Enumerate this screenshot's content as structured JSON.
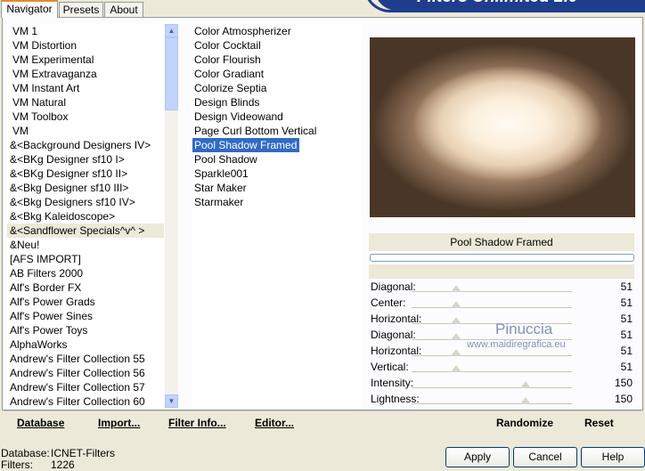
{
  "tabs": [
    "Navigator",
    "Presets",
    "About"
  ],
  "banner_title": "Filters Unlimited 2.0",
  "categories": [
    "VM 1",
    "VM Distortion",
    "VM Experimental",
    "VM Extravaganza",
    "VM Instant Art",
    "VM Natural",
    "VM Toolbox",
    "VM",
    "&<Background Designers IV>",
    "&<BKg Designer sf10 I>",
    "&<BKg Designer sf10 II>",
    "&<Bkg Designer sf10 III>",
    "&<Bkg Designers sf10 IV>",
    "&<Bkg Kaleidoscope>",
    "&<Sandflower Specials^v^ >",
    "&Neu!",
    "[AFS IMPORT]",
    "AB Filters 2000",
    "Alf's Border FX",
    "Alf's Power Grads",
    "Alf's Power Sines",
    "Alf's Power Toys",
    "AlphaWorks",
    "Andrew's Filter Collection 55",
    "Andrew's Filter Collection 56",
    "Andrew's Filter Collection 57",
    "Andrew's Filter Collection 60"
  ],
  "filters": [
    "Color Atmospherizer",
    "Color Cocktail",
    "Color Flourish",
    "Color Gradiant",
    "Colorize Septia",
    "Design Blinds",
    "Design Videowand",
    "Page Curl Bottom Vertical",
    "Pool Shadow Framed",
    "Pool Shadow",
    "Sparkle001",
    "Star Maker",
    "Starmaker"
  ],
  "selected_filter_name": "Pool Shadow Framed",
  "sliders": [
    {
      "label": "Diagonal:",
      "value": "51",
      "level": 0.2
    },
    {
      "label": "Center:",
      "value": "51",
      "level": 0.2
    },
    {
      "label": "Horizontal:",
      "value": "51",
      "level": 0.2
    },
    {
      "label": "Diagonal:",
      "value": "51",
      "level": 0.2
    },
    {
      "label": "Horizontal:",
      "value": "51",
      "level": 0.2
    },
    {
      "label": "Vertical:",
      "value": "51",
      "level": 0.2
    },
    {
      "label": "Intensity:",
      "value": "150",
      "level": 0.59
    },
    {
      "label": "Lightness:",
      "value": "150",
      "level": 0.59
    }
  ],
  "watermark": {
    "name": "Pinuccia",
    "site": "www.maidiregrafica.eu"
  },
  "toolbar": {
    "database": "Database",
    "import": "Import...",
    "filter_info": "Filter Info...",
    "editor": "Editor...",
    "randomize": "Randomize",
    "reset": "Reset"
  },
  "status": {
    "database_label": "Database:",
    "database_value": "ICNET-Filters",
    "filters_label": "Filters:",
    "filters_value": "1226"
  },
  "buttons": {
    "apply": "Apply",
    "cancel": "Cancel",
    "help": "Help"
  }
}
